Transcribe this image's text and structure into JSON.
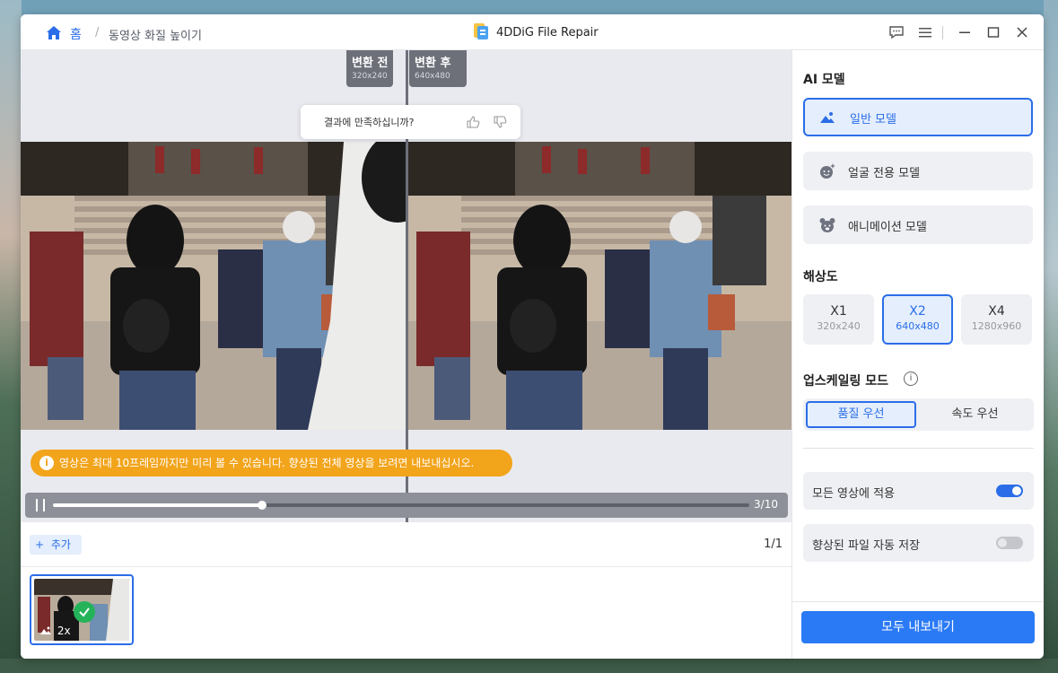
{
  "titlebar": {
    "home_label": "홈",
    "separator": "/",
    "breadcrumb_current": "동영상 화질 높이기",
    "app_title": "4DDiG File Repair"
  },
  "preview": {
    "before_label": "변환 전",
    "before_res": "320x240",
    "after_label": "변환 후",
    "after_res": "640x480",
    "feedback_question": "결과에 만족하십니까?",
    "notice_icon": "i",
    "notice": "영상은 최대 10프레임까지만 미리 볼 수 있습니다. 향상된 전체 영상을 보려면 내보내십시오.",
    "progress_fraction": 0.3,
    "frame_counter": "3/10"
  },
  "file_list": {
    "add_label": "추가",
    "page_count": "1/1",
    "thumb_scale": "2x"
  },
  "panel": {
    "ai_model_title": "AI 모델",
    "models": [
      {
        "label": "일반 모델",
        "icon": "landscape-icon",
        "selected": true
      },
      {
        "label": "얼굴 전용 모델",
        "icon": "face-sparkle-icon",
        "selected": false
      },
      {
        "label": "애니메이션 모델",
        "icon": "bear-icon",
        "selected": false
      }
    ],
    "resolution_title": "해상도",
    "resolutions": [
      {
        "scale": "X1",
        "size": "320x240",
        "selected": false
      },
      {
        "scale": "X2",
        "size": "640x480",
        "selected": true
      },
      {
        "scale": "X4",
        "size": "1280x960",
        "selected": false
      }
    ],
    "upscale_title": "업스케일링 모드",
    "info_icon": "i",
    "modes": [
      {
        "label": "품질 우선",
        "selected": true
      },
      {
        "label": "속도 우선",
        "selected": false
      }
    ],
    "apply_all_label": "모든 영상에 적용",
    "apply_all_on": true,
    "auto_save_label": "향상된 파일 자동 저장",
    "auto_save_on": false,
    "export_label": "모두 내보내기"
  },
  "colors": {
    "accent": "#2b6de8",
    "notice": "#f2a41b",
    "success": "#25b35a"
  }
}
